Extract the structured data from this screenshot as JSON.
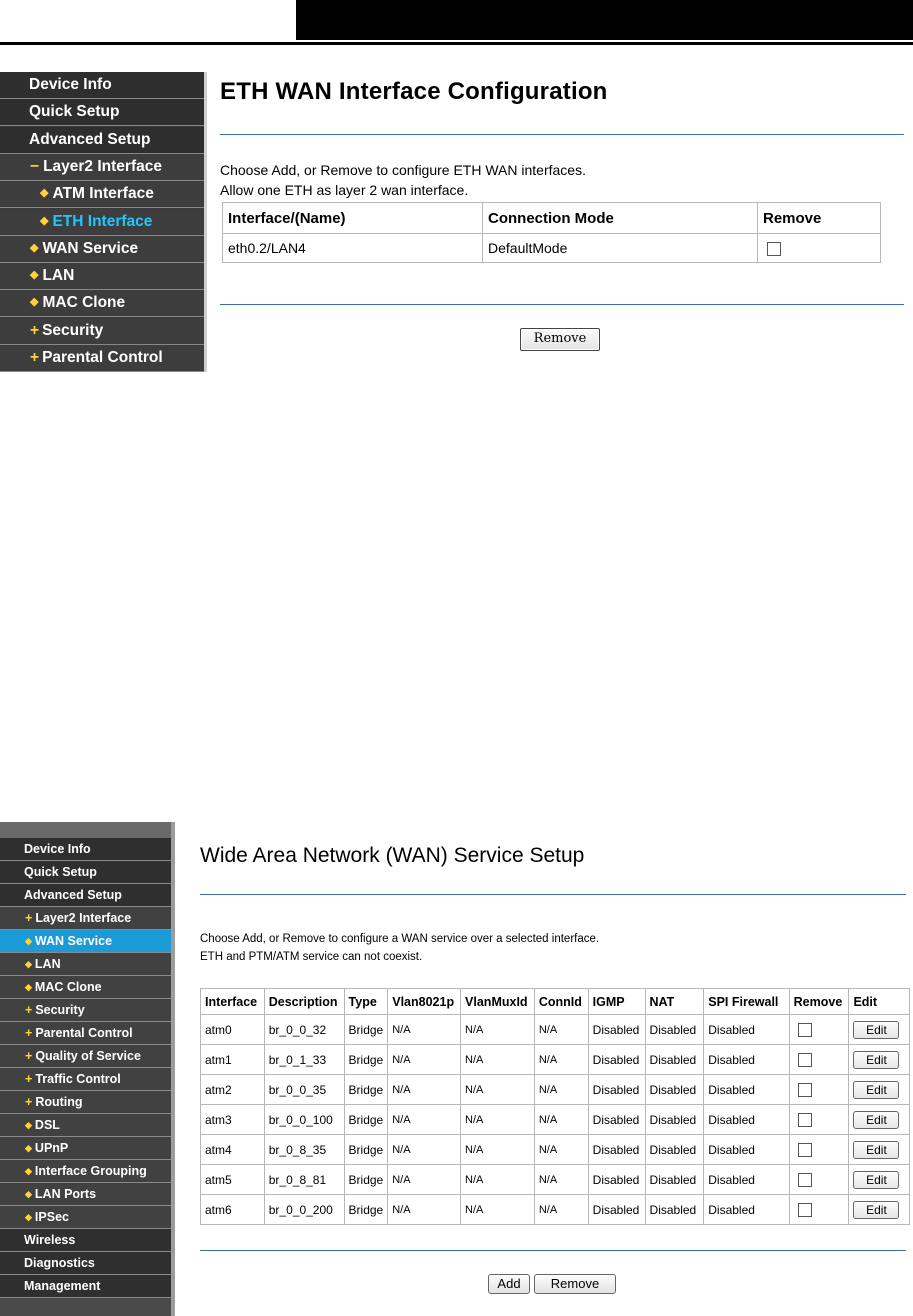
{
  "page1": {
    "nav": [
      {
        "label": "Device Info",
        "level": 0
      },
      {
        "label": "Quick Setup",
        "level": 0
      },
      {
        "label": "Advanced Setup",
        "level": 0
      },
      {
        "label": "Layer2 Interface",
        "level": 1,
        "marker": "minus"
      },
      {
        "label": "ATM Interface",
        "level": 2,
        "marker": "bullet"
      },
      {
        "label": "ETH Interface",
        "level": 2,
        "marker": "bullet",
        "active": true
      },
      {
        "label": "WAN Service",
        "level": 1,
        "marker": "bullet"
      },
      {
        "label": "LAN",
        "level": 1,
        "marker": "bullet"
      },
      {
        "label": "MAC Clone",
        "level": 1,
        "marker": "bullet"
      },
      {
        "label": "Security",
        "level": 1,
        "marker": "plus"
      },
      {
        "label": "Parental Control",
        "level": 1,
        "marker": "plus"
      }
    ],
    "title": "ETH WAN Interface Configuration",
    "line1": "Choose Add, or Remove to configure ETH WAN interfaces.",
    "line2": "Allow one ETH as layer 2 wan interface.",
    "table": {
      "headers": [
        "Interface/(Name)",
        "Connection Mode",
        "Remove"
      ],
      "rows": [
        [
          "eth0.2/LAN4",
          "DefaultMode"
        ]
      ]
    },
    "remove_label": "Remove"
  },
  "page2": {
    "nav": [
      {
        "label": "Device Info",
        "level": 0
      },
      {
        "label": "Quick Setup",
        "level": 0
      },
      {
        "label": "Advanced Setup",
        "level": 0
      },
      {
        "label": "Layer2 Interface",
        "level": 1,
        "marker": "plus"
      },
      {
        "label": "WAN Service",
        "level": 1,
        "marker": "bullet",
        "active": true
      },
      {
        "label": "LAN",
        "level": 1,
        "marker": "bullet"
      },
      {
        "label": "MAC Clone",
        "level": 1,
        "marker": "bullet"
      },
      {
        "label": "Security",
        "level": 1,
        "marker": "plus"
      },
      {
        "label": "Parental Control",
        "level": 1,
        "marker": "plus"
      },
      {
        "label": "Quality of Service",
        "level": 1,
        "marker": "plus"
      },
      {
        "label": "Traffic Control",
        "level": 1,
        "marker": "plus"
      },
      {
        "label": "Routing",
        "level": 1,
        "marker": "plus"
      },
      {
        "label": "DSL",
        "level": 1,
        "marker": "bullet"
      },
      {
        "label": "UPnP",
        "level": 1,
        "marker": "bullet"
      },
      {
        "label": "Interface Grouping",
        "level": 1,
        "marker": "bullet"
      },
      {
        "label": "LAN Ports",
        "level": 1,
        "marker": "bullet"
      },
      {
        "label": "IPSec",
        "level": 1,
        "marker": "bullet"
      },
      {
        "label": "Wireless",
        "level": 0
      },
      {
        "label": "Diagnostics",
        "level": 0
      },
      {
        "label": "Management",
        "level": 0
      }
    ],
    "title": "Wide Area Network (WAN) Service Setup",
    "line1": "Choose Add, or Remove to configure a WAN service over a selected interface.",
    "line2": "ETH and PTM/ATM service can not coexist.",
    "table": {
      "headers": [
        "Interface",
        "Description",
        "Type",
        "Vlan8021p",
        "VlanMuxId",
        "ConnId",
        "IGMP",
        "NAT",
        "SPI Firewall",
        "Remove",
        "Edit"
      ],
      "rows": [
        [
          "atm0",
          "br_0_0_32",
          "Bridge",
          "N/A",
          "N/A",
          "N/A",
          "Disabled",
          "Disabled",
          "Disabled"
        ],
        [
          "atm1",
          "br_0_1_33",
          "Bridge",
          "N/A",
          "N/A",
          "N/A",
          "Disabled",
          "Disabled",
          "Disabled"
        ],
        [
          "atm2",
          "br_0_0_35",
          "Bridge",
          "N/A",
          "N/A",
          "N/A",
          "Disabled",
          "Disabled",
          "Disabled"
        ],
        [
          "atm3",
          "br_0_0_100",
          "Bridge",
          "N/A",
          "N/A",
          "N/A",
          "Disabled",
          "Disabled",
          "Disabled"
        ],
        [
          "atm4",
          "br_0_8_35",
          "Bridge",
          "N/A",
          "N/A",
          "N/A",
          "Disabled",
          "Disabled",
          "Disabled"
        ],
        [
          "atm5",
          "br_0_8_81",
          "Bridge",
          "N/A",
          "N/A",
          "N/A",
          "Disabled",
          "Disabled",
          "Disabled"
        ],
        [
          "atm6",
          "br_0_0_200",
          "Bridge",
          "N/A",
          "N/A",
          "N/A",
          "Disabled",
          "Disabled",
          "Disabled"
        ]
      ],
      "edit_label": "Edit"
    },
    "add_label": "Add",
    "remove_label": "Remove"
  }
}
